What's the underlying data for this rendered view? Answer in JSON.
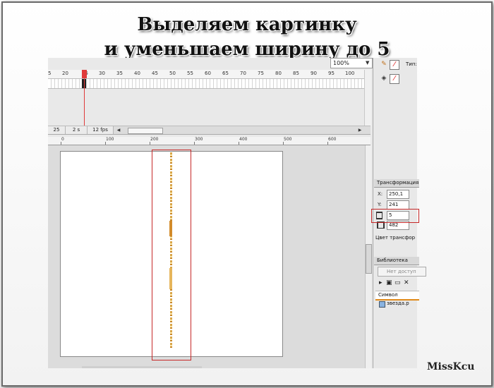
{
  "slide": {
    "title_line1": "Выделяем картинку",
    "title_line2": "и уменьшаем ширину до 5",
    "watermark": "MissKcu"
  },
  "timeline": {
    "zoom": "100%",
    "frame_numbers": [
      "5",
      "20",
      "25",
      "30",
      "35",
      "40",
      "45",
      "50",
      "55",
      "60",
      "65",
      "70",
      "75",
      "80",
      "85",
      "90",
      "95",
      "100"
    ],
    "current_frame": "25",
    "time": "2 s",
    "fps": "12 fps"
  },
  "stage_ruler": {
    "numbers": [
      "0",
      "100",
      "200",
      "300",
      "400",
      "500",
      "600"
    ]
  },
  "tools": {
    "label": "Тип:",
    "pencil_icon": "pencil-icon",
    "stroke_color_icon": "no-color-icon",
    "bucket_icon": "paint-bucket-icon",
    "fill_color_icon": "no-color-icon"
  },
  "transform": {
    "header": "Трансформация",
    "x_label": "X:",
    "x_value": "250,1",
    "y_label": "Y:",
    "y_value": "241",
    "width_value": "5",
    "height_value": "482",
    "color_transform": "Цвет трансфор"
  },
  "library": {
    "header": "Библиотека",
    "select_placeholder": "Нет доступ",
    "column_symbol": "Символ",
    "item": "звезда.р"
  },
  "colors": {
    "highlight": "#c62828",
    "playhead": "#e03a3a",
    "accent": "#e08a1a"
  }
}
